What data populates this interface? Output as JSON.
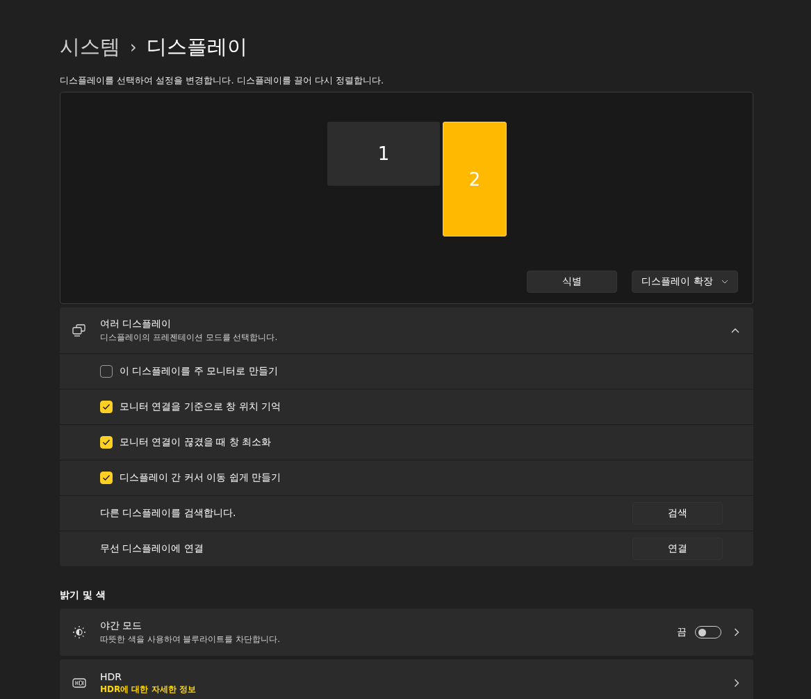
{
  "breadcrumb": {
    "parent": "시스템",
    "separator": "›",
    "current": "디스플레이"
  },
  "description": "디스플레이를 선택하여 설정을 변경합니다. 디스플레이를 끌어 다시 정렬합니다.",
  "arrangement": {
    "monitors": [
      {
        "label": "1",
        "selected": false,
        "kind": "landscape"
      },
      {
        "label": "2",
        "selected": true,
        "kind": "portrait"
      }
    ],
    "identify_button": "식별",
    "mode_dropdown": {
      "value": "디스플레이 확장"
    }
  },
  "multiple_displays": {
    "title": "여러 디스플레이",
    "subtitle": "디스플레이의 프레젠테이션 모드를 선택합니다.",
    "expanded": true,
    "items": [
      {
        "kind": "checkbox",
        "label": "이 디스플레이를 주 모니터로 만들기",
        "checked": false
      },
      {
        "kind": "checkbox",
        "label": "모니터 연결을 기준으로 창 위치 기억",
        "checked": true
      },
      {
        "kind": "checkbox",
        "label": "모니터 연결이 끊겼을 때 창 최소화",
        "checked": true
      },
      {
        "kind": "checkbox",
        "label": "디스플레이 간 커서 이동 쉽게 만들기",
        "checked": true
      },
      {
        "kind": "button",
        "label": "다른 디스플레이를 검색합니다.",
        "button": "검색"
      },
      {
        "kind": "button",
        "label": "무선 디스플레이에 연결",
        "button": "연결"
      }
    ]
  },
  "brightness_section": {
    "heading": "밝기 및 색",
    "cards": [
      {
        "kind": "night",
        "title": "야간 모드",
        "subtitle": "따뜻한 색을 사용하여 블루라이트를 차단합니다.",
        "state_label": "끔",
        "on": false
      },
      {
        "kind": "hdr",
        "title": "HDR",
        "link": "HDR에 대한 자세한 정보"
      }
    ]
  }
}
